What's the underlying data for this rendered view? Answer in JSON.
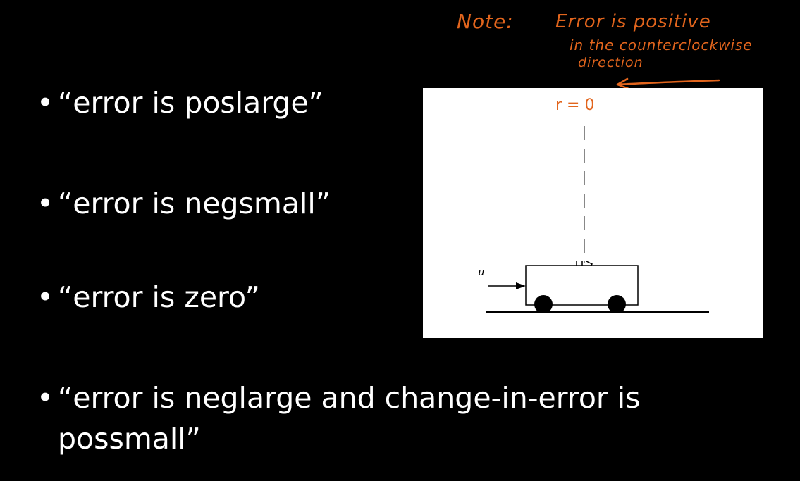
{
  "bullets": [
    {
      "marker": "•",
      "text": "“error is poslarge”"
    },
    {
      "marker": "•",
      "text": "“error is negsmall”"
    },
    {
      "marker": "•",
      "text": "“error is zero”"
    },
    {
      "marker": "•",
      "line1": "“error is neglarge and change-in-error is",
      "line2": "possmall”"
    }
  ],
  "note": {
    "label": "Note:",
    "line1": "Error is positive",
    "line2": "in the counterclockwise",
    "line3": "direction"
  },
  "figure": {
    "reference_label": "r = 0",
    "input_label": "u"
  },
  "colors": {
    "background": "#000000",
    "text": "#ffffff",
    "annotation": "#e2651d",
    "figure_background": "#ffffff"
  }
}
